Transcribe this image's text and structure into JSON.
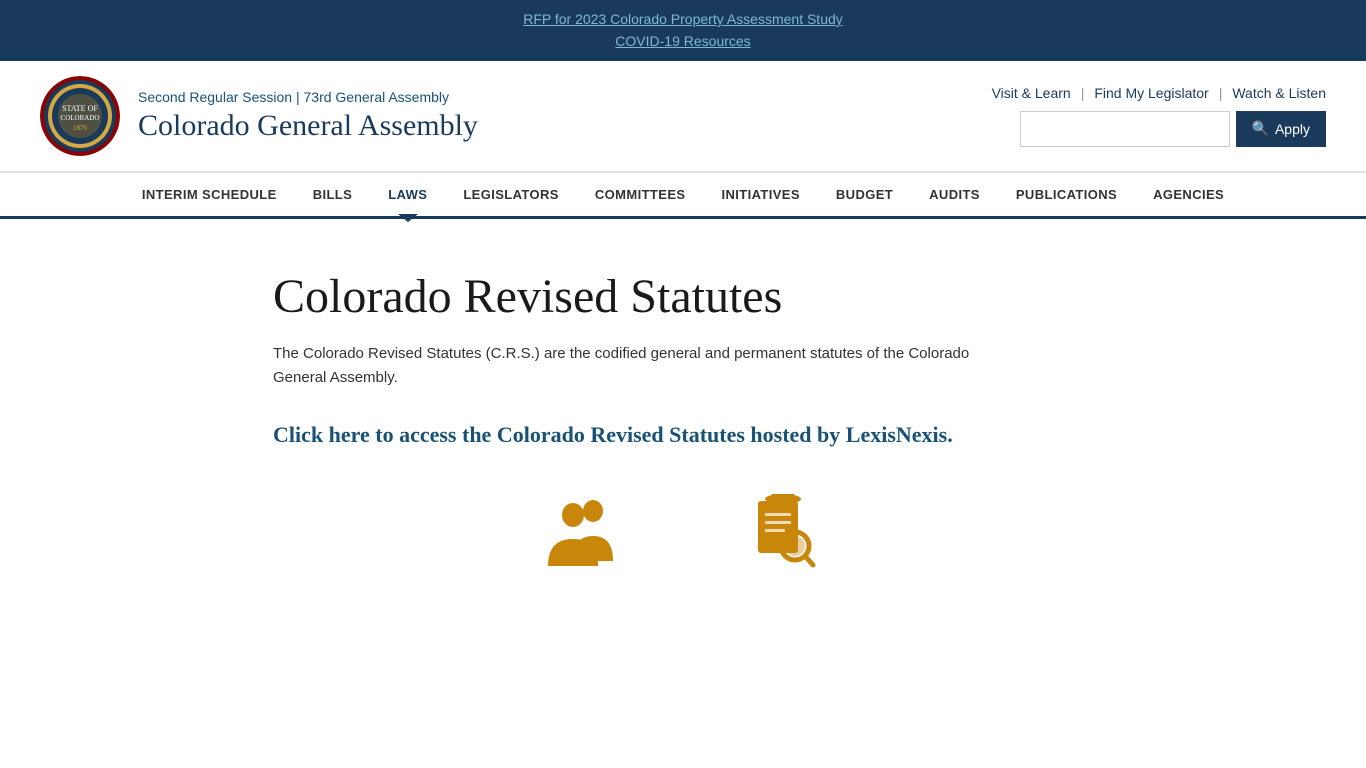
{
  "top_banner": {
    "link1": "RFP for 2023 Colorado Property Assessment Study",
    "link2": "COVID-19 Resources"
  },
  "header": {
    "subtitle": "Second Regular Session | 73rd General Assembly",
    "title": "Colorado General Assembly",
    "links": {
      "visit_learn": "Visit & Learn",
      "find_legislator": "Find My Legislator",
      "watch_listen": "Watch & Listen"
    },
    "search": {
      "placeholder": "",
      "apply_label": "Apply"
    }
  },
  "nav": {
    "items": [
      {
        "label": "INTERIM SCHEDULE",
        "active": false
      },
      {
        "label": "BILLS",
        "active": false
      },
      {
        "label": "LAWS",
        "active": true
      },
      {
        "label": "LEGISLATORS",
        "active": false
      },
      {
        "label": "COMMITTEES",
        "active": false
      },
      {
        "label": "INITIATIVES",
        "active": false
      },
      {
        "label": "BUDGET",
        "active": false
      },
      {
        "label": "AUDITS",
        "active": false
      },
      {
        "label": "PUBLICATIONS",
        "active": false
      },
      {
        "label": "AGENCIES",
        "active": false
      }
    ]
  },
  "main": {
    "page_title": "Colorado Revised Statutes",
    "description": "The Colorado Revised Statutes (C.R.S.) are the codified general and permanent statutes of the Colorado General Assembly.",
    "crs_link_text": "Click here to access the Colorado Revised Statutes hosted by LexisNexis."
  }
}
